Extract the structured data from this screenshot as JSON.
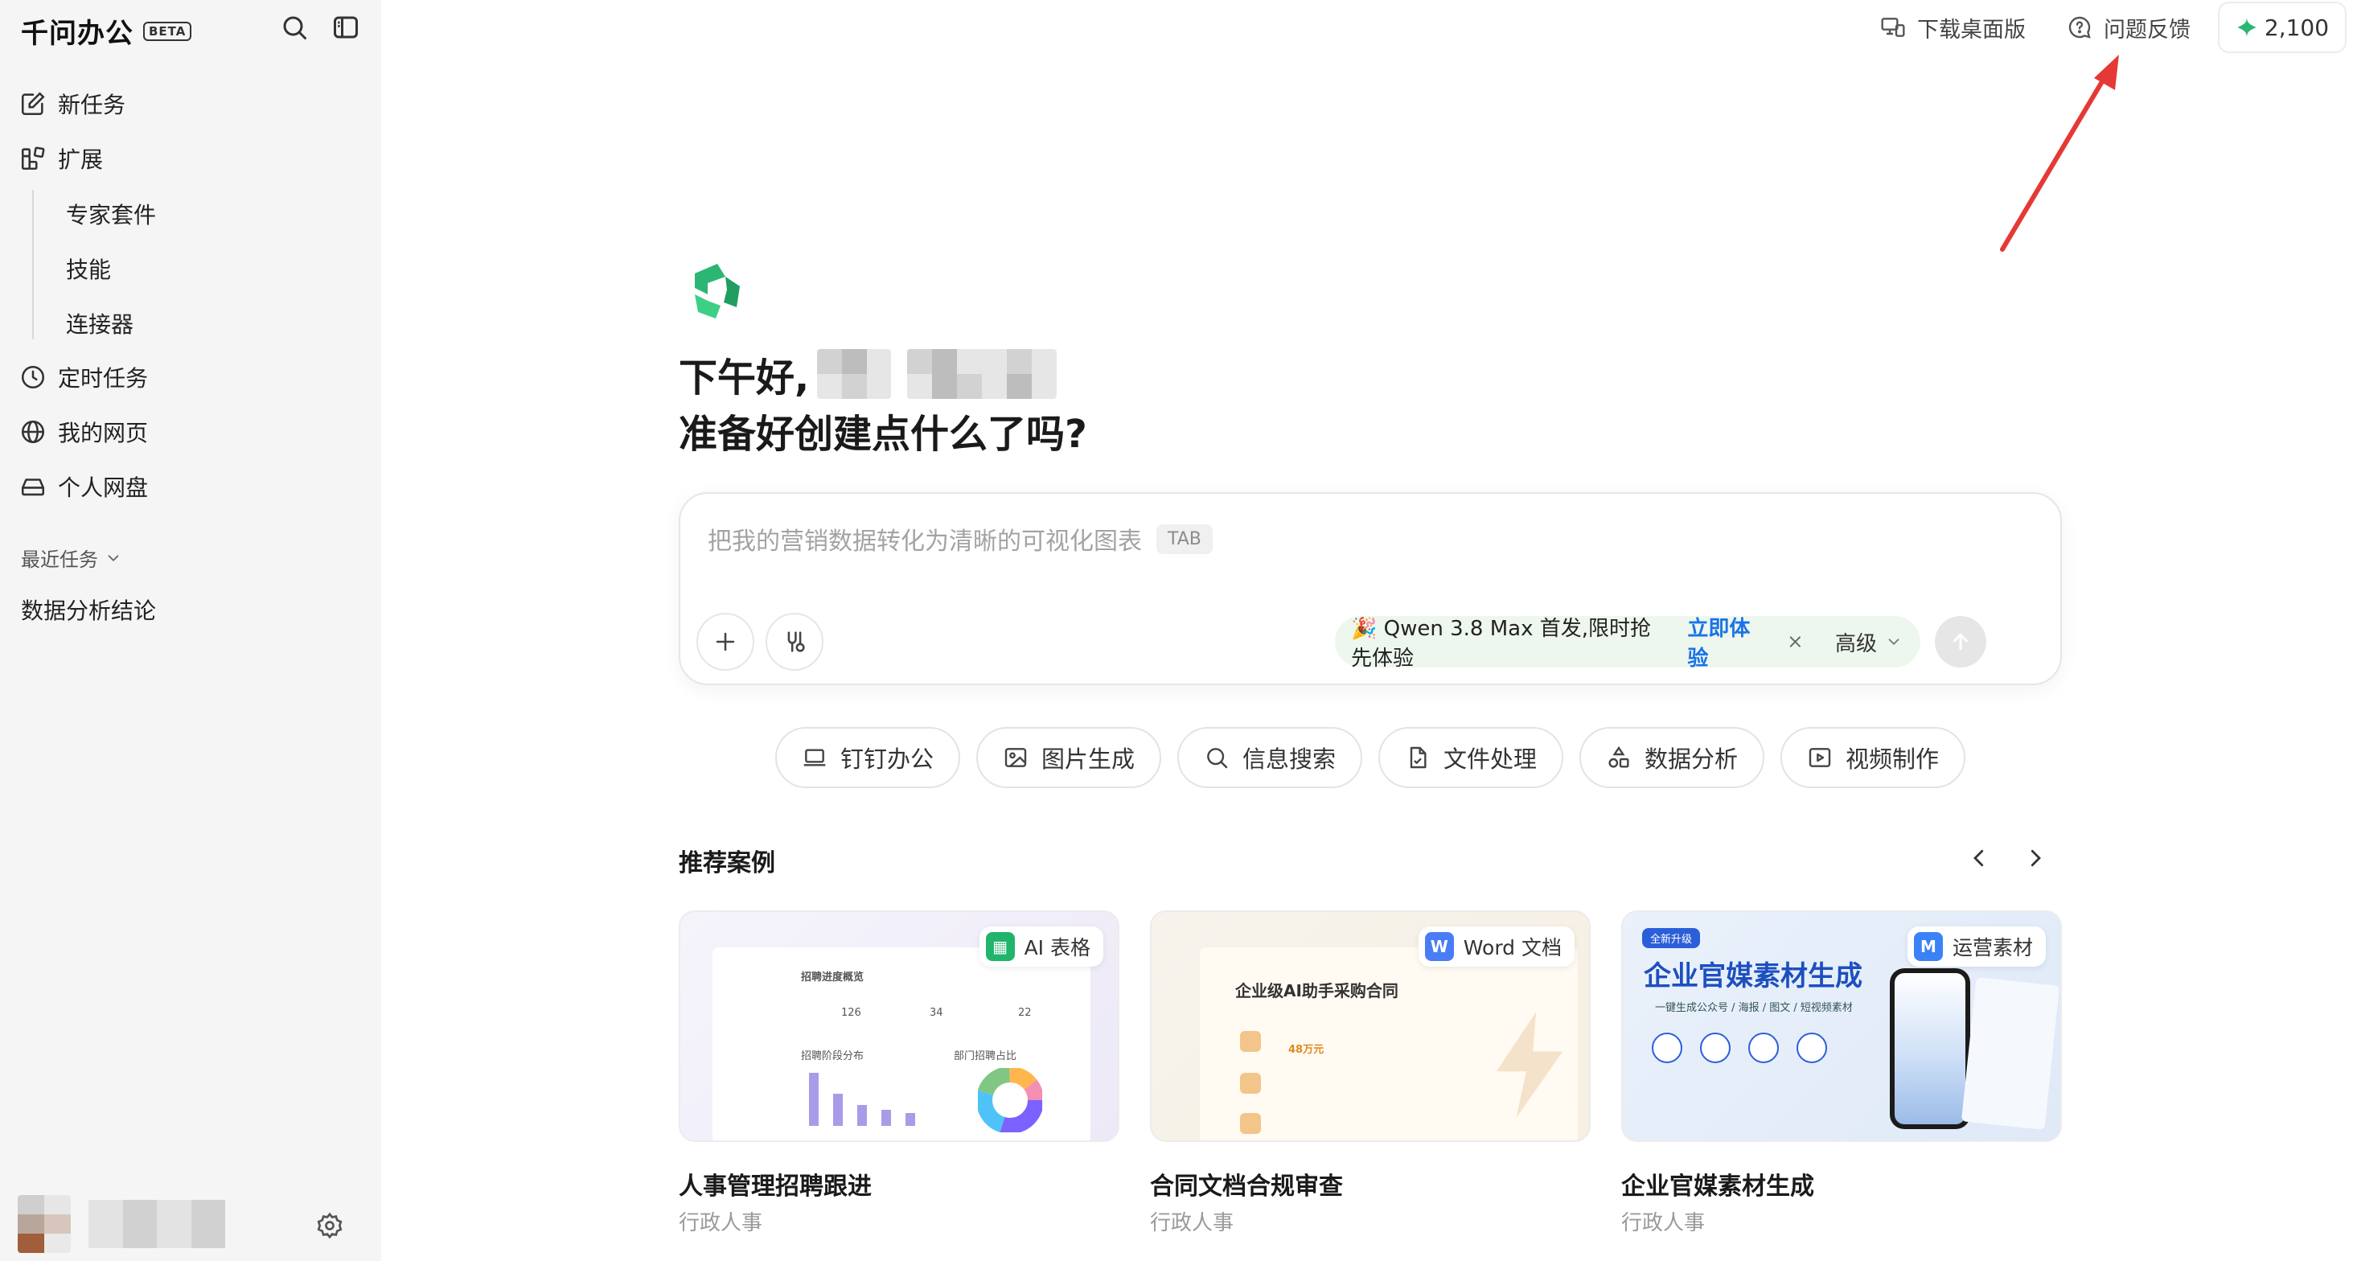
{
  "app": {
    "title": "千问办公",
    "badge": "BETA"
  },
  "sidebar": {
    "new_task": "新任务",
    "extensions": "扩展",
    "sub_items": [
      "专家套件",
      "技能",
      "连接器"
    ],
    "scheduled": "定时任务",
    "my_pages": "我的网页",
    "drive": "个人网盘",
    "recent_label": "最近任务",
    "recent_items": [
      "数据分析结论"
    ]
  },
  "topbar": {
    "download": "下载桌面版",
    "feedback": "问题反馈",
    "points": "2,100"
  },
  "greeting": {
    "line1": "下午好,",
    "line2": "准备好创建点什么了吗?"
  },
  "composer": {
    "placeholder": "把我的营销数据转化为清晰的可视化图表",
    "tab_hint": "TAB",
    "promo_text": "🎉 Qwen 3.8 Max 首发,限时抢先体验",
    "promo_link": "立即体验",
    "advanced": "高级"
  },
  "quick_actions": [
    "钉钉办公",
    "图片生成",
    "信息搜索",
    "文件处理",
    "数据分析",
    "视频制作"
  ],
  "recommend": {
    "title": "推荐案例",
    "cards": [
      {
        "badge": "AI 表格",
        "name": "人事管理招聘跟进",
        "category": "行政人事"
      },
      {
        "badge": "Word 文档",
        "name": "合同文档合规审查",
        "category": "行政人事"
      },
      {
        "badge": "运营素材",
        "name": "企业官媒素材生成",
        "category": "行政人事"
      }
    ]
  },
  "thumb_text": {
    "t1_title": "招聘进度概览",
    "t1_stats": [
      "126",
      "34",
      "22"
    ],
    "t1_chart": "招聘阶段分布",
    "t1_pie": "部门招聘占比",
    "t2_title": "企业级AI助手采购合同",
    "t2_amount": "48万元",
    "t3_tag": "全新升级",
    "t3_title": "企业官媒素材生成",
    "t3_sub": "一键生成公众号 / 海报 / 图文 / 短视频素材"
  },
  "colors": {
    "brand_green": "#2bb673",
    "link_blue": "#1a73e8",
    "annotation_red": "#e53935"
  }
}
